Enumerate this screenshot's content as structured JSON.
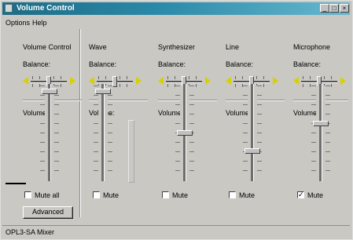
{
  "window": {
    "title": "Volume Control"
  },
  "menu": [
    {
      "label": "Options",
      "hotkey": "O"
    },
    {
      "label": "Help",
      "hotkey": "H"
    }
  ],
  "channels": [
    {
      "name": "Volume Control",
      "balance_label": "Balance:",
      "volume_label": "Volume:",
      "mute_label": "Mute all",
      "muted": false,
      "volume_level": 0.95,
      "balance_level": 0.5
    },
    {
      "name": "Wave",
      "balance_label": "Balance:",
      "volume_label": "Volume:",
      "mute_label": "Mute",
      "muted": false,
      "volume_level": 0.95,
      "balance_level": 0.5
    },
    {
      "name": "Synthesizer",
      "balance_label": "Balance:",
      "volume_label": "Volume:",
      "mute_label": "Mute",
      "muted": false,
      "volume_level": 0.5,
      "balance_level": 0.5
    },
    {
      "name": "Line",
      "balance_label": "Balance:",
      "volume_label": "Volume:",
      "mute_label": "Mute",
      "muted": false,
      "volume_level": 0.3,
      "balance_level": 0.5
    },
    {
      "name": "Microphone",
      "balance_label": "Balance:",
      "volume_label": "Volume:",
      "mute_label": "Mute",
      "muted": true,
      "volume_level": 0.6,
      "balance_level": 0.5
    }
  ],
  "advanced_button": {
    "label": "Advanced",
    "hotkey": "A"
  },
  "status": "OPL3-SA Mixer",
  "icons": {
    "speaker_left": "speaker-left-icon",
    "speaker_right": "speaker-right-icon",
    "app": "speaker-app-icon"
  },
  "colors": {
    "title_start": "#1e6b85",
    "title_end": "#67b8cf",
    "face": "#c9c8c3",
    "speaker": "#d8d000"
  }
}
